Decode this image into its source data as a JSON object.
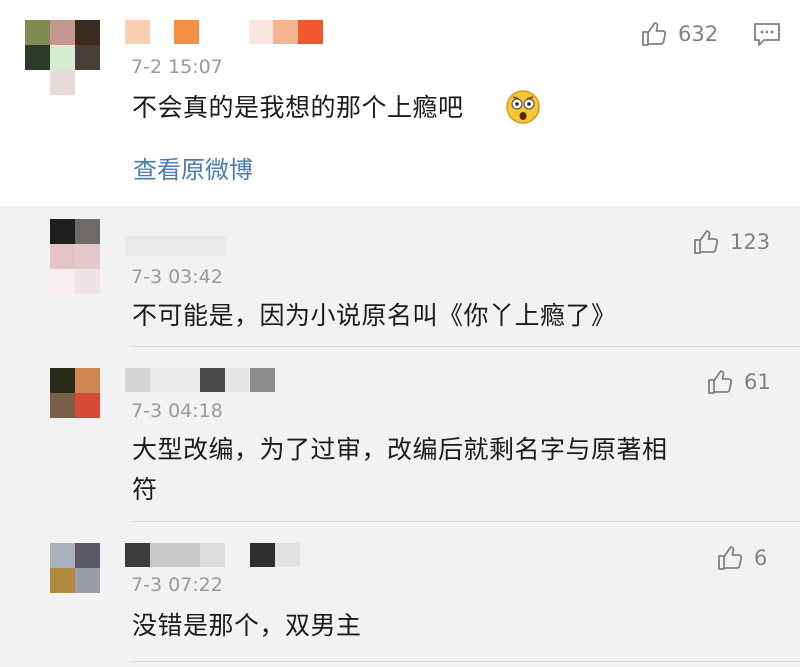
{
  "colors": {
    "link": "#4a7bb3",
    "meta": "#9a9a9a",
    "like": "#808080",
    "main_bg": "#ffffff",
    "reply_bg": "#f2f2f2"
  },
  "main_comment": {
    "time": "7-2 15:07",
    "text": "不会真的是我想的那个上瘾吧",
    "emoji": "shocked-face",
    "likes": "632",
    "view_original": "查看原微博"
  },
  "replies": [
    {
      "time": "7-3 03:42",
      "text": "不可能是，因为小说原名叫《你丫上瘾了》",
      "likes": "123"
    },
    {
      "time": "7-3 04:18",
      "text_line1": "大型改编，为了过审，改编后就剩名字与原著相",
      "text_line2": "符",
      "likes": "61"
    },
    {
      "time": "7-3 07:22",
      "text": "没错是那个，双男主",
      "likes": "6"
    }
  ],
  "icons": [
    "thumbs-up-icon",
    "comment-reply-icon",
    "shocked-face-emoji"
  ]
}
